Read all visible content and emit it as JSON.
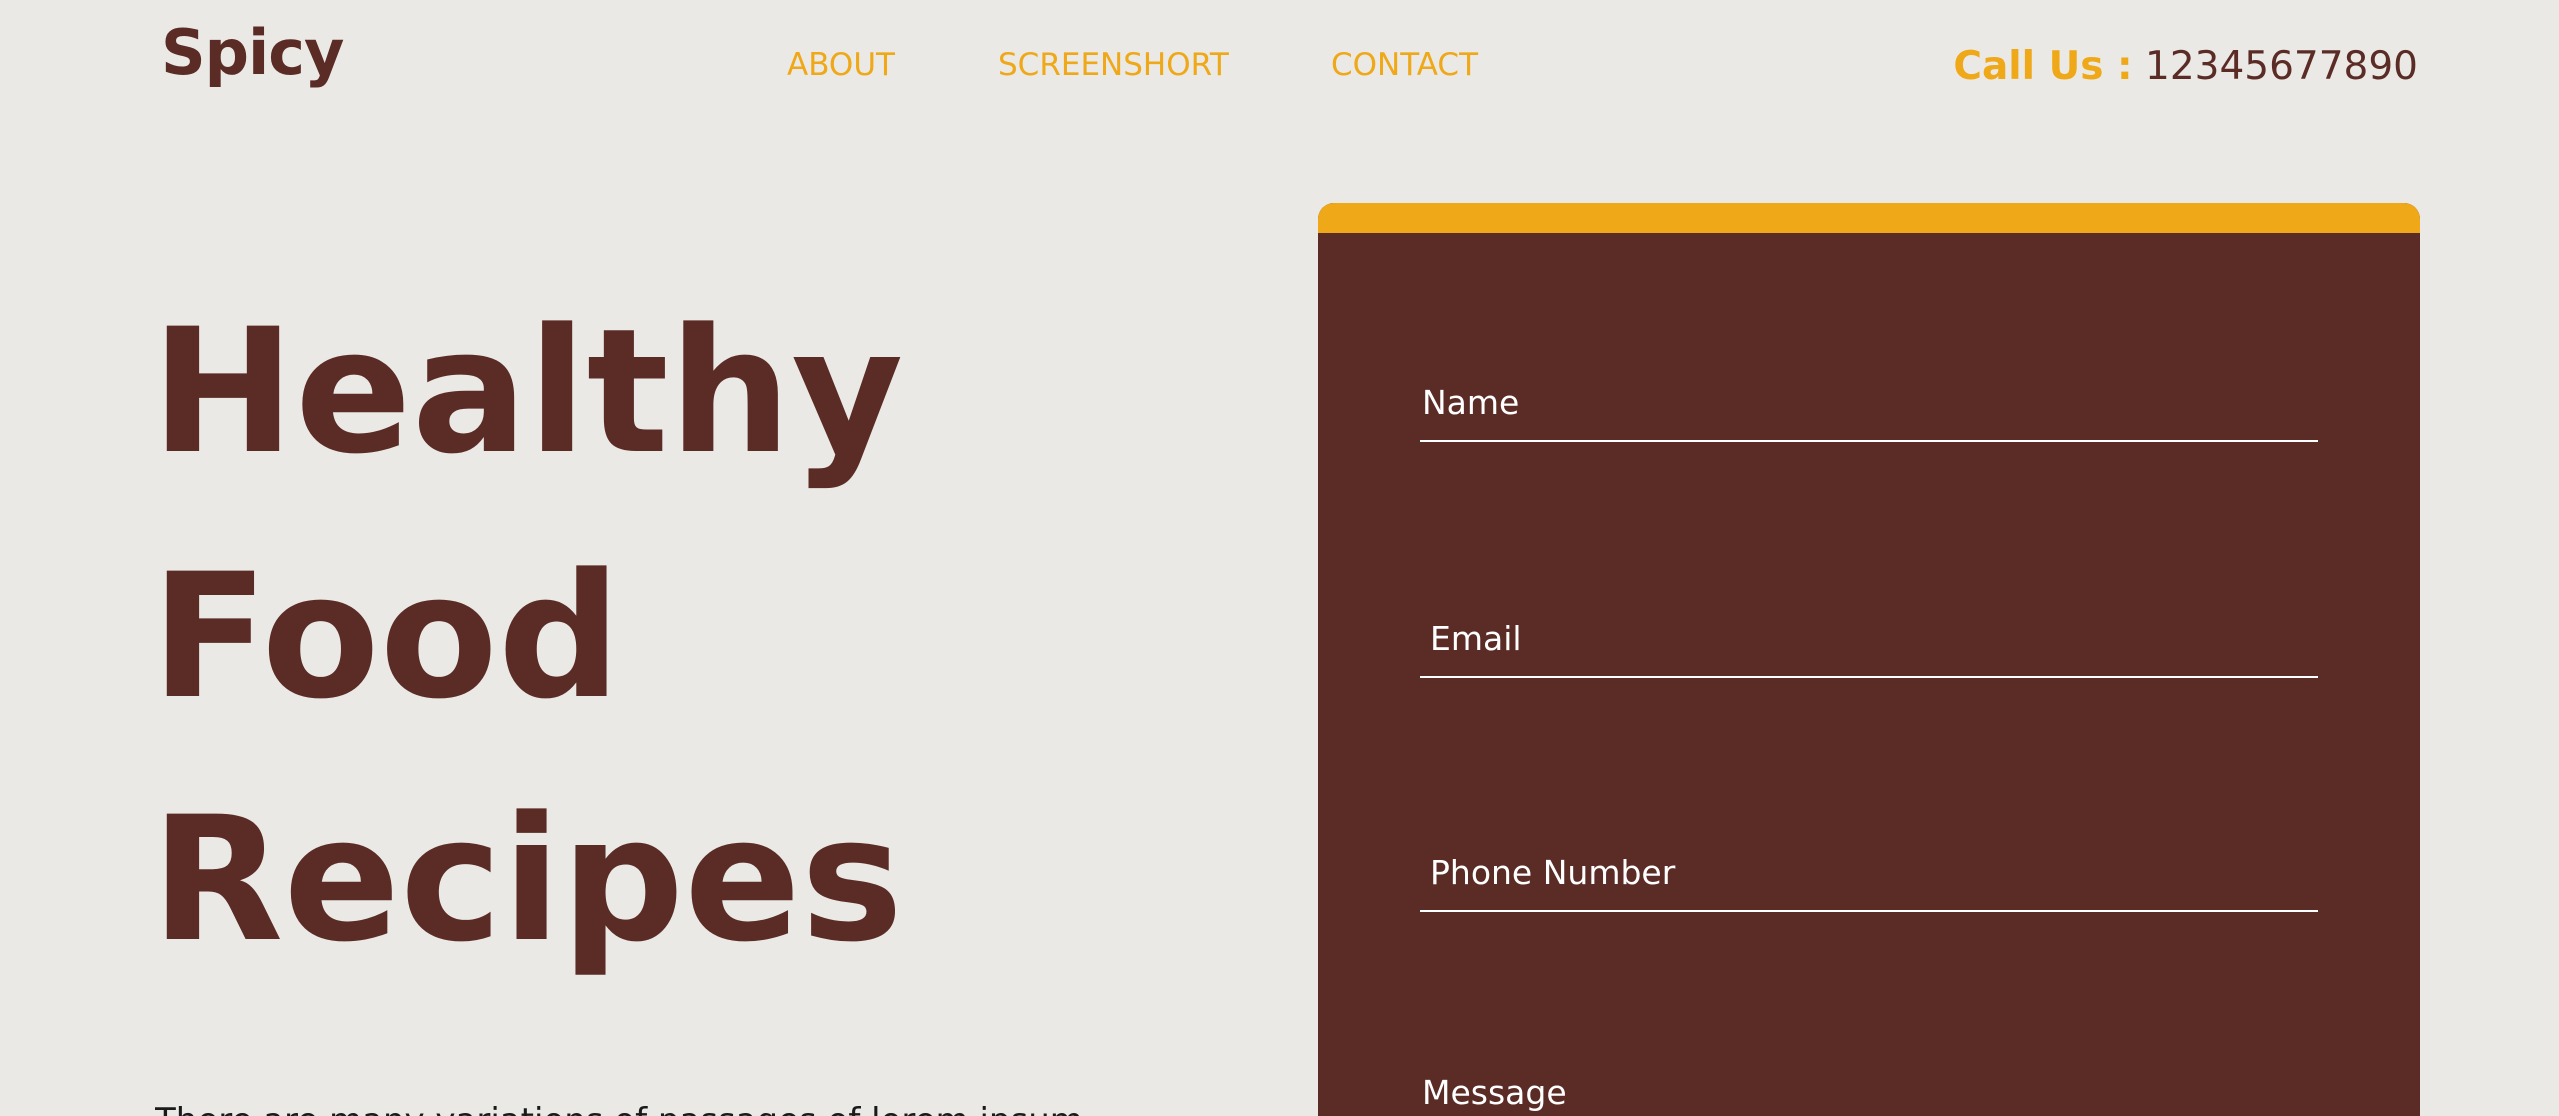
{
  "header": {
    "logo": "Spicy",
    "nav": [
      {
        "label": "ABOUT"
      },
      {
        "label": "SCREENSHORT"
      },
      {
        "label": "CONTACT"
      }
    ],
    "call_label": "Call Us :",
    "call_number": "12345677890"
  },
  "hero": {
    "lines": [
      "Healthy",
      "Food",
      "Recipes"
    ],
    "subtext": "There are many variations of passages of lorem ipsum"
  },
  "form": {
    "name_placeholder": "Name",
    "email_placeholder": "Email",
    "phone_placeholder": "Phone Number",
    "message_placeholder": "Message"
  },
  "colors": {
    "background": "#ebe9e5",
    "brand_brown": "#5b2c26",
    "accent_yellow": "#eea818"
  }
}
